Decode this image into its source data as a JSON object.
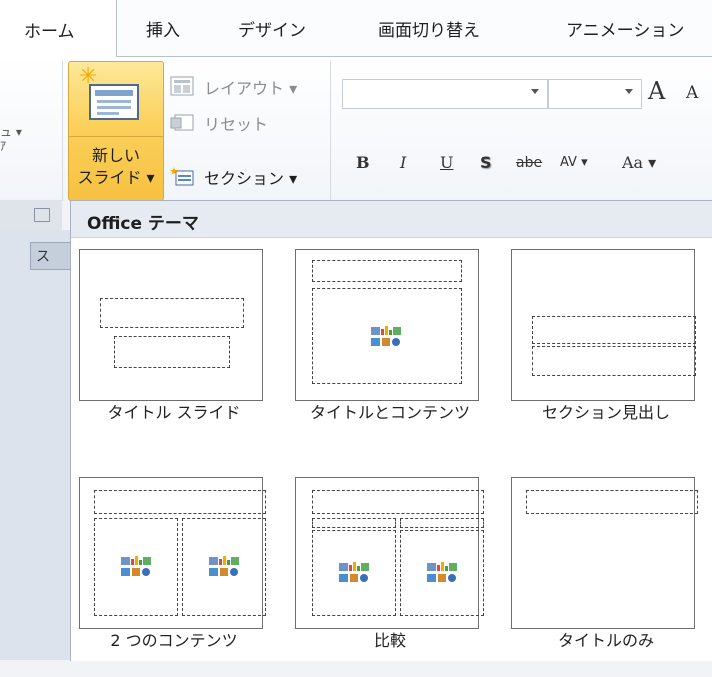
{
  "tabs": {
    "home": "ホーム",
    "insert": "挿入",
    "design": "デザイン",
    "transitions": "画面切り替え",
    "animations": "アニメーション"
  },
  "ribbon": {
    "left_stub_1": "ュ ▾",
    "left_stub_2": "ｱ",
    "new_slide_line1": "新しい",
    "new_slide_line2": "スライド ▾",
    "layout_label": "レイアウト ▾",
    "reset_label": "リセット",
    "section_label": "セクション ▾",
    "font_name": "",
    "font_size": "",
    "grow_font": "A",
    "shrink_font": "A",
    "bold": "B",
    "italic": "I",
    "underline": "U",
    "shadow": "S",
    "strike": "abe",
    "spacing": "AV ▾",
    "case": "Aa ▾"
  },
  "left_pane": {
    "tab_label": "ス"
  },
  "gallery": {
    "title": "Office テーマ",
    "layouts": [
      {
        "label": "タイトル スライド"
      },
      {
        "label": "タイトルとコンテンツ"
      },
      {
        "label": "セクション見出し"
      },
      {
        "label": "2 つのコンテンツ"
      },
      {
        "label": "比較"
      },
      {
        "label": "タイトルのみ"
      }
    ]
  },
  "colors": {
    "selected_button": "#f9cf5c",
    "ribbon_bg": "#f5f7fa",
    "gallery_header": "#e6ebf1"
  }
}
